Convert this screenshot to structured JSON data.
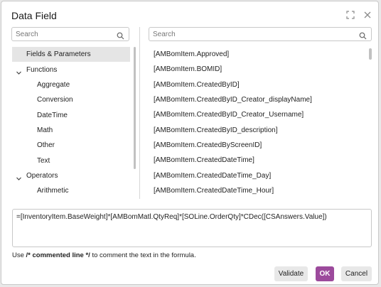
{
  "dialog": {
    "title": "Data Field",
    "maximize_icon": "maximize-icon",
    "close_icon": "close-icon"
  },
  "left_search": {
    "placeholder": "Search",
    "value": ""
  },
  "right_search": {
    "placeholder": "Search",
    "value": ""
  },
  "tree": {
    "items": [
      {
        "label": "Fields & Parameters",
        "level": 0,
        "selected": true,
        "expandable": false
      },
      {
        "label": "Functions",
        "level": 0,
        "selected": false,
        "expandable": true,
        "expanded": true
      },
      {
        "label": "Aggregate",
        "level": 1,
        "selected": false,
        "expandable": false
      },
      {
        "label": "Conversion",
        "level": 1,
        "selected": false,
        "expandable": false
      },
      {
        "label": "DateTime",
        "level": 1,
        "selected": false,
        "expandable": false
      },
      {
        "label": "Math",
        "level": 1,
        "selected": false,
        "expandable": false
      },
      {
        "label": "Other",
        "level": 1,
        "selected": false,
        "expandable": false
      },
      {
        "label": "Text",
        "level": 1,
        "selected": false,
        "expandable": false
      },
      {
        "label": "Operators",
        "level": 0,
        "selected": false,
        "expandable": true,
        "expanded": true
      },
      {
        "label": "Arithmetic",
        "level": 1,
        "selected": false,
        "expandable": false
      }
    ]
  },
  "fields": [
    "[AMBomItem.Approved]",
    "[AMBomItem.BOMID]",
    "[AMBomItem.CreatedByID]",
    "[AMBomItem.CreatedByID_Creator_displayName]",
    "[AMBomItem.CreatedByID_Creator_Username]",
    "[AMBomItem.CreatedByID_description]",
    "[AMBomItem.CreatedByScreenID]",
    "[AMBomItem.CreatedDateTime]",
    "[AMBomItem.CreatedDateTime_Day]",
    "[AMBomItem.CreatedDateTime_Hour]"
  ],
  "formula": "=[InventoryItem.BaseWeight]*[AMBomMatl.QtyReq]*[SOLine.OrderQty]*CDec([CSAnswers.Value])",
  "hint": {
    "prefix": "Use ",
    "bold": "/* commented line */",
    "suffix": " to comment the text in the formula."
  },
  "buttons": {
    "validate": "Validate",
    "ok": "OK",
    "cancel": "Cancel"
  },
  "colors": {
    "accent": "#9c4a9c",
    "selected_row": "#e5e5e5",
    "border": "#c8c8c8"
  }
}
